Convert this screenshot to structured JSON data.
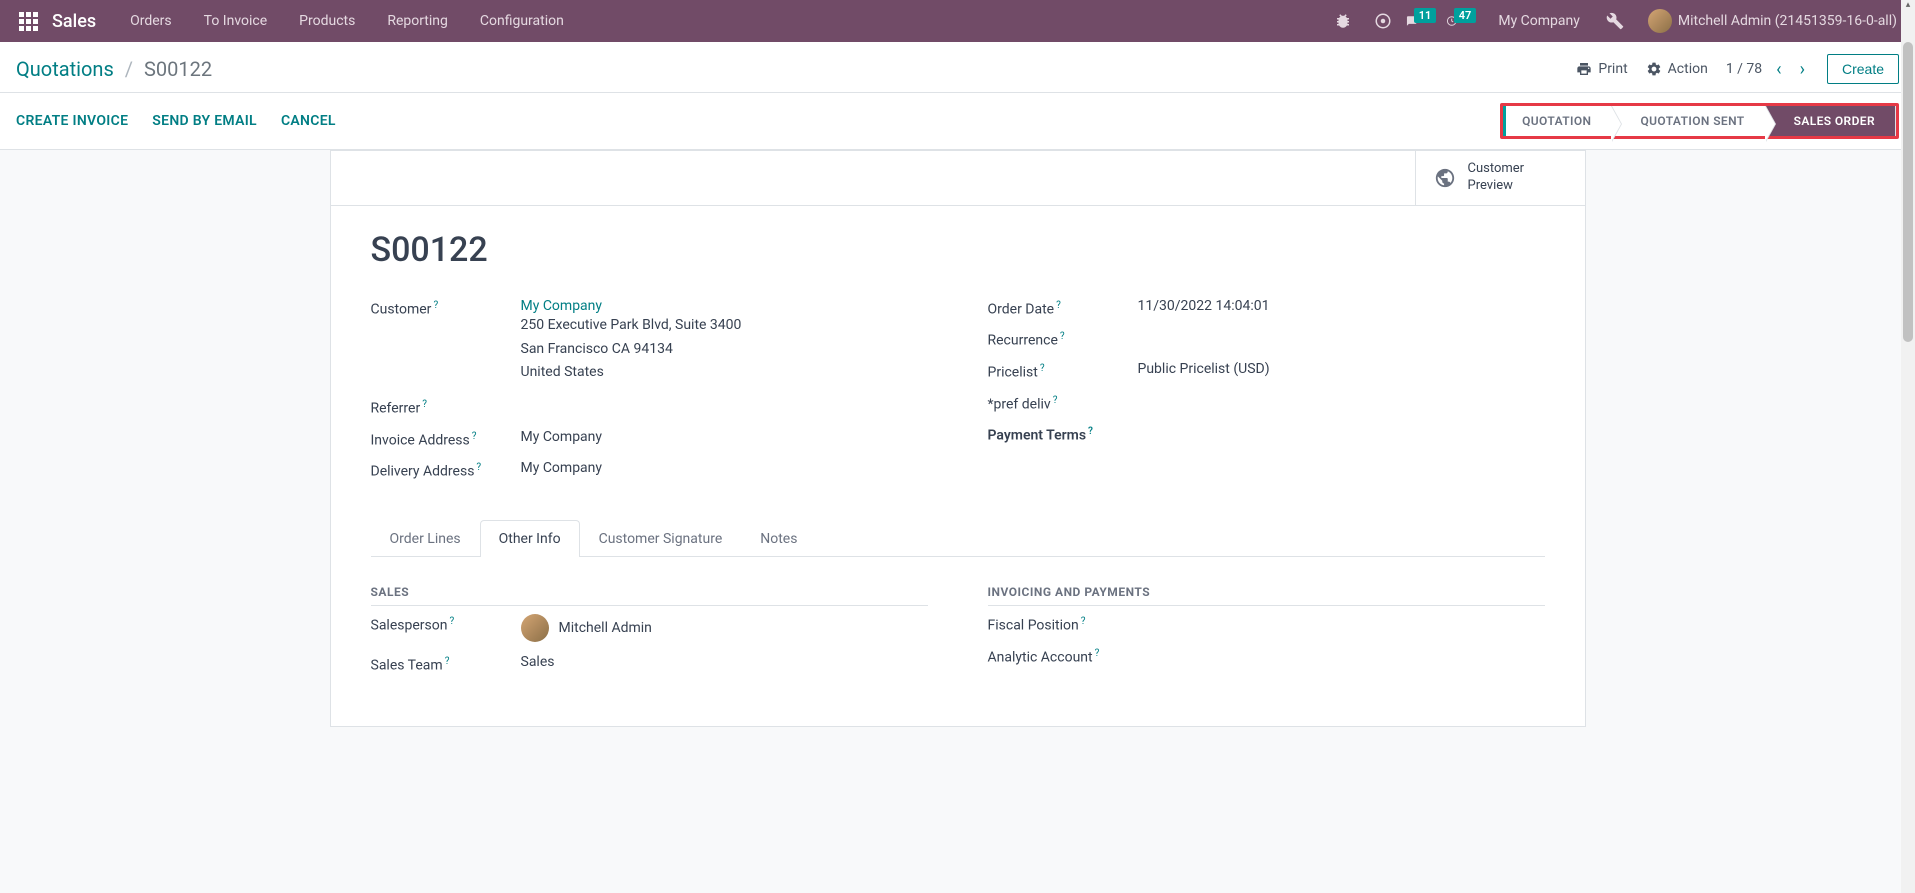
{
  "nav": {
    "brand": "Sales",
    "links": [
      "Orders",
      "To Invoice",
      "Products",
      "Reporting",
      "Configuration"
    ],
    "messages_badge": "11",
    "activities_badge": "47",
    "company": "My Company",
    "user": "Mitchell Admin (21451359-16-0-all)"
  },
  "breadcrumb": {
    "parent": "Quotations",
    "current": "S00122"
  },
  "controls": {
    "print": "Print",
    "action": "Action",
    "pager": "1 / 78",
    "create": "Create"
  },
  "actions": {
    "create_invoice": "CREATE INVOICE",
    "send_email": "SEND BY EMAIL",
    "cancel": "CANCEL"
  },
  "statusbar": {
    "quotation": "QUOTATION",
    "quotation_sent": "QUOTATION SENT",
    "sales_order": "SALES ORDER"
  },
  "stat_buttons": {
    "customer_preview": "Customer\nPreview"
  },
  "record": {
    "name": "S00122",
    "fields_left": {
      "customer": {
        "label": "Customer",
        "value": "My Company",
        "addr1": "250 Executive Park Blvd, Suite 3400",
        "addr2": "San Francisco CA 94134",
        "addr3": "United States"
      },
      "referrer": {
        "label": "Referrer",
        "value": ""
      },
      "invoice_address": {
        "label": "Invoice Address",
        "value": "My Company"
      },
      "delivery_address": {
        "label": "Delivery Address",
        "value": "My Company"
      }
    },
    "fields_right": {
      "order_date": {
        "label": "Order Date",
        "value": "11/30/2022 14:04:01"
      },
      "recurrence": {
        "label": "Recurrence",
        "value": ""
      },
      "pricelist": {
        "label": "Pricelist",
        "value": "Public Pricelist (USD)"
      },
      "pref_deliv": {
        "label": "*pref deliv",
        "value": ""
      },
      "payment_terms": {
        "label": "Payment Terms",
        "value": ""
      }
    }
  },
  "tabs": [
    "Order Lines",
    "Other Info",
    "Customer Signature",
    "Notes"
  ],
  "other_info": {
    "sales_header": "SALES",
    "invoicing_header": "INVOICING AND PAYMENTS",
    "salesperson": {
      "label": "Salesperson",
      "value": "Mitchell Admin"
    },
    "sales_team": {
      "label": "Sales Team",
      "value": "Sales"
    },
    "fiscal_position": {
      "label": "Fiscal Position",
      "value": ""
    },
    "analytic_account": {
      "label": "Analytic Account",
      "value": ""
    }
  }
}
